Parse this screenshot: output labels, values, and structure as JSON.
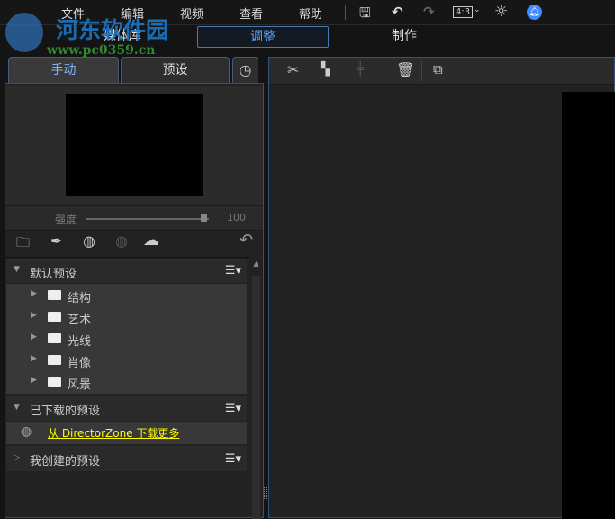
{
  "watermark": {
    "name": "河东软件园",
    "url": "www.pc0359.cn"
  },
  "menu": [
    "文件",
    "编辑",
    "视频",
    "查看",
    "帮助"
  ],
  "toolbar": {
    "aspect": "4:3"
  },
  "modes": [
    "媒体库",
    "调整",
    "制作"
  ],
  "tabs": [
    "手动",
    "预设"
  ],
  "strength": {
    "label": "强度",
    "value": "100",
    "fraction": 1.0
  },
  "sections": [
    {
      "title": "默认预设",
      "items": [
        "结构",
        "艺术",
        "光线",
        "肖像",
        "风景"
      ]
    },
    {
      "title": "已下载的预设",
      "link": "从 DirectorZone 下载更多"
    },
    {
      "title": "我创建的预设"
    }
  ],
  "colors": {
    "accent": "#5ba4ff",
    "link": "#ffff00",
    "border": "#2f5480"
  }
}
